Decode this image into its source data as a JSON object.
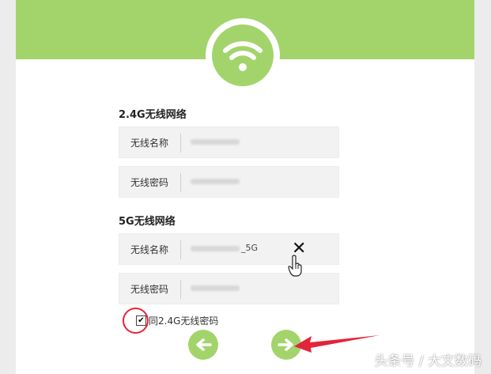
{
  "colors": {
    "accent": "#a3d46b",
    "annotation_red": "#e3243a"
  },
  "wifi_24g": {
    "title": "2.4G无线网络",
    "ssid_label": "无线名称",
    "ssid_value": "",
    "password_label": "无线密码",
    "password_value": ""
  },
  "wifi_5g": {
    "title": "5G无线网络",
    "ssid_label": "无线名称",
    "ssid_value": "_5G",
    "password_label": "无线密码",
    "password_value": ""
  },
  "same_password": {
    "label": "同2.4G无线密码",
    "checked": true
  },
  "nav": {
    "back_icon": "arrow-left-icon",
    "next_icon": "arrow-right-icon"
  },
  "watermark": "头条号 / 大文数码"
}
